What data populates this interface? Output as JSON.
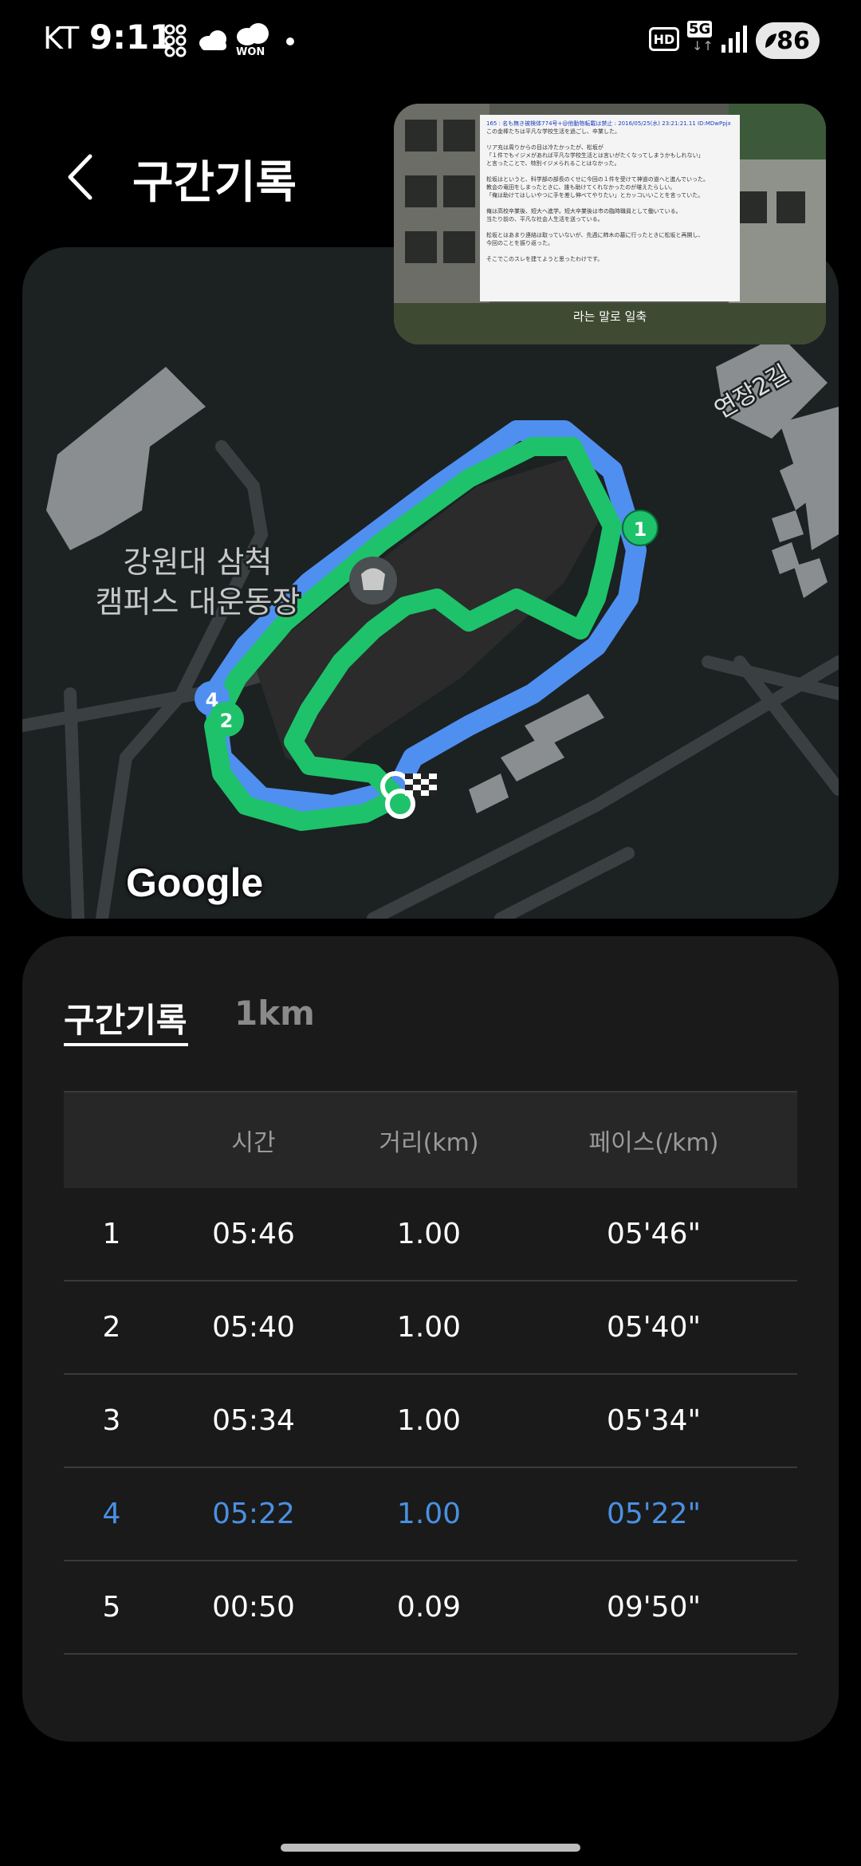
{
  "status_bar": {
    "carrier": "KT",
    "time": "9:11",
    "battery": "86",
    "icons": [
      "grid-icon",
      "cloud-icon",
      "won-badge-icon",
      "dot-icon",
      "hd-icon",
      "5g-icon",
      "signal-icon",
      "battery-icon"
    ],
    "won_label": "WON",
    "hd_label": "HD",
    "net_label": "5G"
  },
  "header": {
    "title": "구간기록",
    "back_icon": "chevron-left-icon"
  },
  "map": {
    "place_label_line1": "강원대 삼척",
    "place_label_line2": "캠퍼스 대운동장",
    "road_label": "연장2길",
    "google_label": "Google",
    "markers": [
      "1",
      "2",
      "4"
    ],
    "route_colors": {
      "blue": "#4f8ff0",
      "green": "#1ec26a"
    }
  },
  "pip": {
    "doc_lines": [
      "165 : 名も無き被検体774号+@他動物転載は禁止 : 2016/05/25(水) 23:21:21.11 ID:MDwPpjx",
      "この金棒たちは平凡な学校生活を過ごし、卒業した。",
      "",
      "リア充は周りからの目は冷たかったが、松坂が",
      "「１件でもイジメがあれば平凡な学校生活とは言いがたくなってしまうかもしれない」",
      "と言ったことで、特別イジメられることはなかった。",
      "",
      "松坂はというと、科学部の部長のくせに今回の１件を受けて神道の道へと進んでいった。",
      "教会の竜田をしまったときに、誰も助けてくれなかったのが堪えたらしい。",
      "「俺は助けてはしいやつに手を差し伸べてやりたい」とカッコいいことを言っていた。",
      "",
      "俺は高校卒業後、短大へ進学。短大卒業後は市の臨時職員として働いている。",
      "当たり前の、平凡な社会人生活を送っている。",
      "",
      "松坂とはあまり連絡は取っていないが、先週に柿木の墓に行ったときに松坂と再開し、",
      "今回のことを振り返った。",
      "",
      "そこでこのスレを建てようと思ったわけです。"
    ],
    "caption": "라는 말로 일축"
  },
  "tabs": [
    {
      "label": "구간기록",
      "active": true
    },
    {
      "label": "1km",
      "active": false
    }
  ],
  "table": {
    "headers": [
      "",
      "시간",
      "거리(km)",
      "페이스(/km)"
    ],
    "rows": [
      {
        "lap": "1",
        "time": "05:46",
        "distance": "1.00",
        "pace": "05'46\""
      },
      {
        "lap": "2",
        "time": "05:40",
        "distance": "1.00",
        "pace": "05'40\""
      },
      {
        "lap": "3",
        "time": "05:34",
        "distance": "1.00",
        "pace": "05'34\""
      },
      {
        "lap": "4",
        "time": "05:22",
        "distance": "1.00",
        "pace": "05'22\""
      },
      {
        "lap": "5",
        "time": "00:50",
        "distance": "0.09",
        "pace": "09'50\""
      }
    ],
    "highlight_row": 3,
    "highlight_color": "#4a90e2"
  }
}
